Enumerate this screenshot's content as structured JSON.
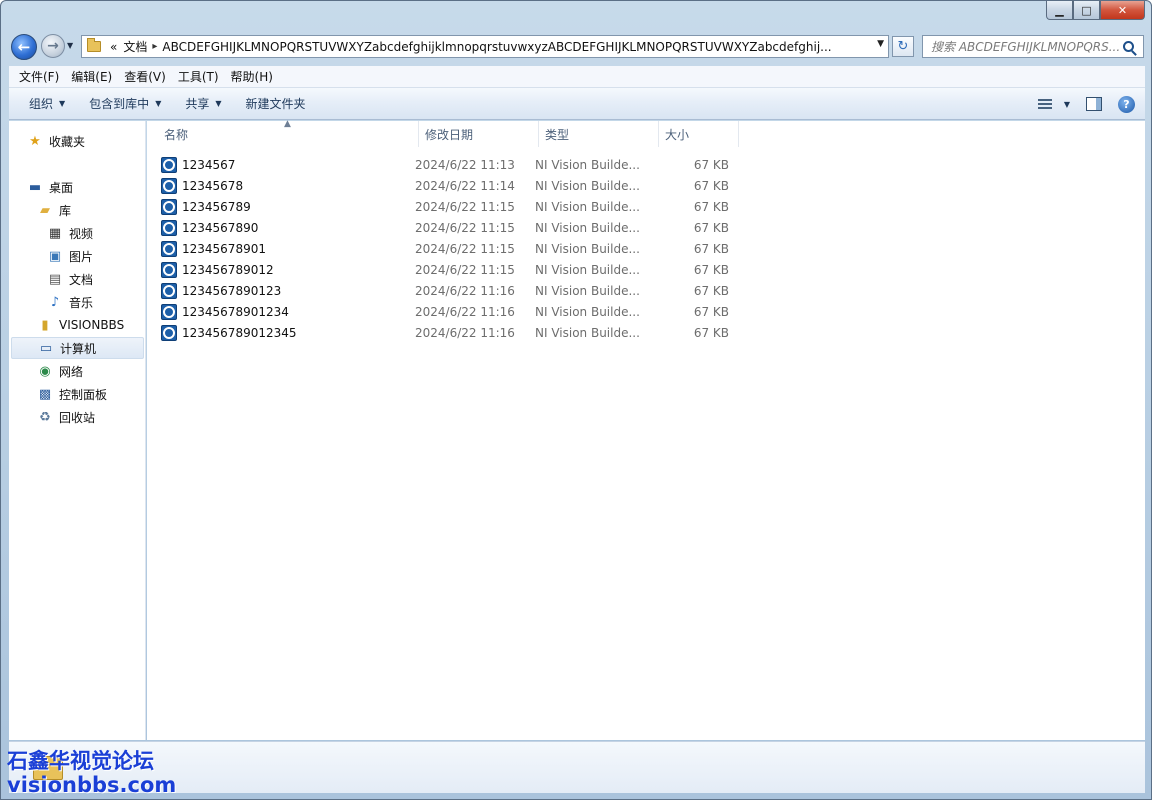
{
  "window": {
    "caption_buttons": {
      "minimize": "▁",
      "maximize": "□",
      "close": "✕"
    }
  },
  "address": {
    "overflow": "«",
    "segments": [
      "文档",
      "ABCDEFGHIJKLMNOPQRSTUVWXYZabcdefghijklmnopqrstuvwxyzABCDEFGHIJKLMNOPQRSTUVWXYZabcdefghij..."
    ],
    "back_glyph": "←",
    "forward_glyph": "→",
    "refresh_glyph": "↻"
  },
  "search": {
    "placeholder": "搜索 ABCDEFGHIJKLMNOPQRS..."
  },
  "menubar": [
    "文件(F)",
    "编辑(E)",
    "查看(V)",
    "工具(T)",
    "帮助(H)"
  ],
  "commandbar": {
    "organize": "组织",
    "include_library": "包含到库中",
    "share": "共享",
    "new_folder": "新建文件夹",
    "help_glyph": "?"
  },
  "nav": {
    "favorites": "收藏夹",
    "desktop": "桌面",
    "libraries": "库",
    "videos": "视频",
    "pictures": "图片",
    "documents": "文档",
    "music": "音乐",
    "visionbbs": "VISIONBBS",
    "computer": "计算机",
    "network": "网络",
    "control_panel": "控制面板",
    "recycle_bin": "回收站"
  },
  "columns": {
    "name": "名称",
    "date": "修改日期",
    "type": "类型",
    "size": "大小"
  },
  "files": [
    {
      "name": "1234567",
      "date": "2024/6/22 11:13",
      "type": "NI Vision Builde...",
      "size": "67 KB"
    },
    {
      "name": "12345678",
      "date": "2024/6/22 11:14",
      "type": "NI Vision Builde...",
      "size": "67 KB"
    },
    {
      "name": "123456789",
      "date": "2024/6/22 11:15",
      "type": "NI Vision Builde...",
      "size": "67 KB"
    },
    {
      "name": "1234567890",
      "date": "2024/6/22 11:15",
      "type": "NI Vision Builde...",
      "size": "67 KB"
    },
    {
      "name": "12345678901",
      "date": "2024/6/22 11:15",
      "type": "NI Vision Builde...",
      "size": "67 KB"
    },
    {
      "name": "123456789012",
      "date": "2024/6/22 11:15",
      "type": "NI Vision Builde...",
      "size": "67 KB"
    },
    {
      "name": "1234567890123",
      "date": "2024/6/22 11:16",
      "type": "NI Vision Builde...",
      "size": "67 KB"
    },
    {
      "name": "12345678901234",
      "date": "2024/6/22 11:16",
      "type": "NI Vision Builde...",
      "size": "67 KB"
    },
    {
      "name": "123456789012345",
      "date": "2024/6/22 11:16",
      "type": "NI Vision Builde...",
      "size": "67 KB"
    }
  ],
  "watermark": {
    "line1": "石鑫华视觉论坛",
    "line2": "visionbbs.com"
  }
}
